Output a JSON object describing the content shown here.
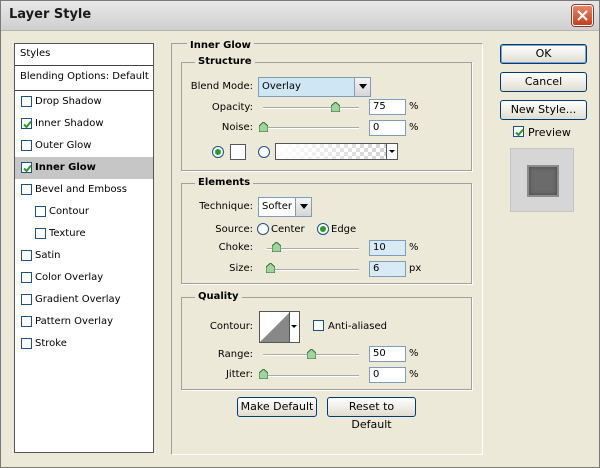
{
  "window": {
    "title": "Layer Style"
  },
  "styles_panel": {
    "header": "Styles",
    "blending_options": "Blending Options: Default",
    "items": [
      {
        "label": "Drop Shadow",
        "checked": false
      },
      {
        "label": "Inner Shadow",
        "checked": true
      },
      {
        "label": "Outer Glow",
        "checked": false
      },
      {
        "label": "Inner Glow",
        "checked": true,
        "selected": true
      },
      {
        "label": "Bevel and Emboss",
        "checked": false
      },
      {
        "label": "Contour",
        "checked": false,
        "sub": true
      },
      {
        "label": "Texture",
        "checked": false,
        "sub": true
      },
      {
        "label": "Satin",
        "checked": false
      },
      {
        "label": "Color Overlay",
        "checked": false
      },
      {
        "label": "Gradient Overlay",
        "checked": false
      },
      {
        "label": "Pattern Overlay",
        "checked": false
      },
      {
        "label": "Stroke",
        "checked": false
      }
    ]
  },
  "inner_glow": {
    "title": "Inner Glow",
    "structure": {
      "title": "Structure",
      "blend_mode_label": "Blend Mode:",
      "blend_mode_value": "Overlay",
      "opacity_label": "Opacity:",
      "opacity_value": "75",
      "opacity_level": 0.75,
      "noise_label": "Noise:",
      "noise_value": "0",
      "noise_level": 0,
      "percent": "%",
      "color_mode": "solid",
      "glow_color": "#ffffff"
    },
    "elements": {
      "title": "Elements",
      "technique_label": "Technique:",
      "technique_value": "Softer",
      "source_label": "Source:",
      "source_center": "Center",
      "source_edge": "Edge",
      "source_selected": "Edge",
      "choke_label": "Choke:",
      "choke_value": "10",
      "choke_level": 0.1,
      "size_label": "Size:",
      "size_value": "6",
      "size_unit": "px",
      "size_level": 0.03,
      "percent": "%"
    },
    "quality": {
      "title": "Quality",
      "contour_label": "Contour:",
      "anti_aliased_label": "Anti-aliased",
      "anti_aliased_checked": false,
      "range_label": "Range:",
      "range_value": "50",
      "range_level": 0.5,
      "jitter_label": "Jitter:",
      "jitter_value": "0",
      "jitter_level": 0,
      "percent": "%"
    },
    "make_default": "Make Default",
    "reset_default": "Reset to Default"
  },
  "actions": {
    "ok": "OK",
    "cancel": "Cancel",
    "new_style": "New Style...",
    "preview_label": "Preview",
    "preview_checked": true
  },
  "colors": {
    "accent": "#2a9a2a",
    "selection": "#c6c6c6",
    "input_highlight": "#d9eaf7"
  }
}
